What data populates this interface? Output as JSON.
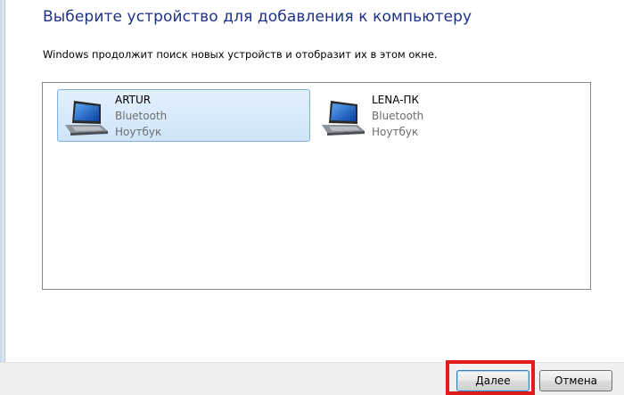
{
  "dialog": {
    "heading": "Выберите устройство для добавления к компьютеру",
    "subtext": "Windows продолжит поиск новых устройств и отобразит их в этом окне."
  },
  "devices": [
    {
      "name": "ARTUR",
      "connection": "Bluetooth",
      "type": "Ноутбук",
      "selected": true,
      "icon": "laptop-icon"
    },
    {
      "name": "LENA-ПК",
      "connection": "Bluetooth",
      "type": "Ноутбук",
      "selected": false,
      "icon": "laptop-icon"
    }
  ],
  "buttons": {
    "next_label": "Далее",
    "cancel_label": "Отмена"
  },
  "colors": {
    "heading": "#1e3287",
    "selection": "#cfe5fb",
    "highlight_frame": "#e01d1d"
  }
}
